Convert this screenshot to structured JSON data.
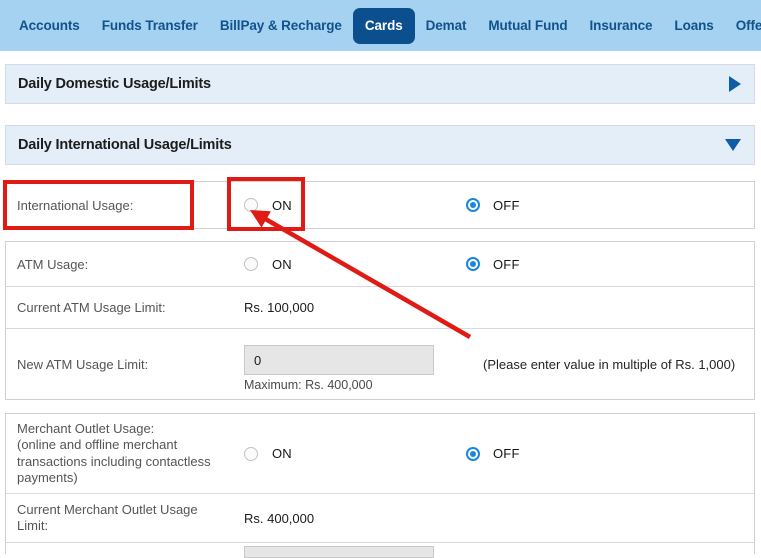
{
  "nav": {
    "items": [
      {
        "label": "Accounts",
        "active": false
      },
      {
        "label": "Funds Transfer",
        "active": false
      },
      {
        "label": "BillPay & Recharge",
        "active": false
      },
      {
        "label": "Cards",
        "active": true
      },
      {
        "label": "Demat",
        "active": false
      },
      {
        "label": "Mutual Fund",
        "active": false
      },
      {
        "label": "Insurance",
        "active": false
      },
      {
        "label": "Loans",
        "active": false
      },
      {
        "label": "Offers",
        "active": false
      }
    ],
    "active_tab": "Cards",
    "background_color": "#a4d2f0",
    "active_tab_color": "#0c4f8f",
    "text_color": "#12518c"
  },
  "accordions": {
    "domestic": {
      "title": "Daily Domestic Usage/Limits",
      "arrow_icon": "triangle-right-icon",
      "expanded": false
    },
    "international": {
      "title": "Daily International Usage/Limits",
      "arrow_icon": "triangle-down-icon",
      "expanded": true
    }
  },
  "rows": {
    "international_usage": {
      "label": "International Usage:",
      "on_label": "ON",
      "off_label": "OFF",
      "selected": "OFF"
    },
    "atm_usage": {
      "label": "ATM Usage:",
      "on_label": "ON",
      "off_label": "OFF",
      "selected": "OFF"
    },
    "current_atm_limit": {
      "label": "Current ATM Usage Limit:",
      "value": "Rs. 100,000"
    },
    "new_atm_limit": {
      "label": "New ATM Usage Limit:",
      "input_value": "0",
      "input_placeholder": "0",
      "maximum_note": "Maximum: Rs. 400,000",
      "hint": "(Please enter value in multiple of Rs. 1,000)"
    },
    "merchant_outlet_usage": {
      "label": "Merchant Outlet Usage:\n(online and offline merchant\ntransactions including contactless\npayments)",
      "on_label": "ON",
      "off_label": "OFF",
      "selected": "OFF"
    },
    "current_merchant_limit": {
      "label": "Current Merchant Outlet Usage\nLimit:",
      "value": "Rs. 400,000"
    }
  },
  "annotations": {
    "color": "#e01b16",
    "box_label": "highlight-international-usage-label",
    "box_radio": "highlight-international-usage-on-radio",
    "arrow": "arrow-pointing-to-on-radio"
  }
}
